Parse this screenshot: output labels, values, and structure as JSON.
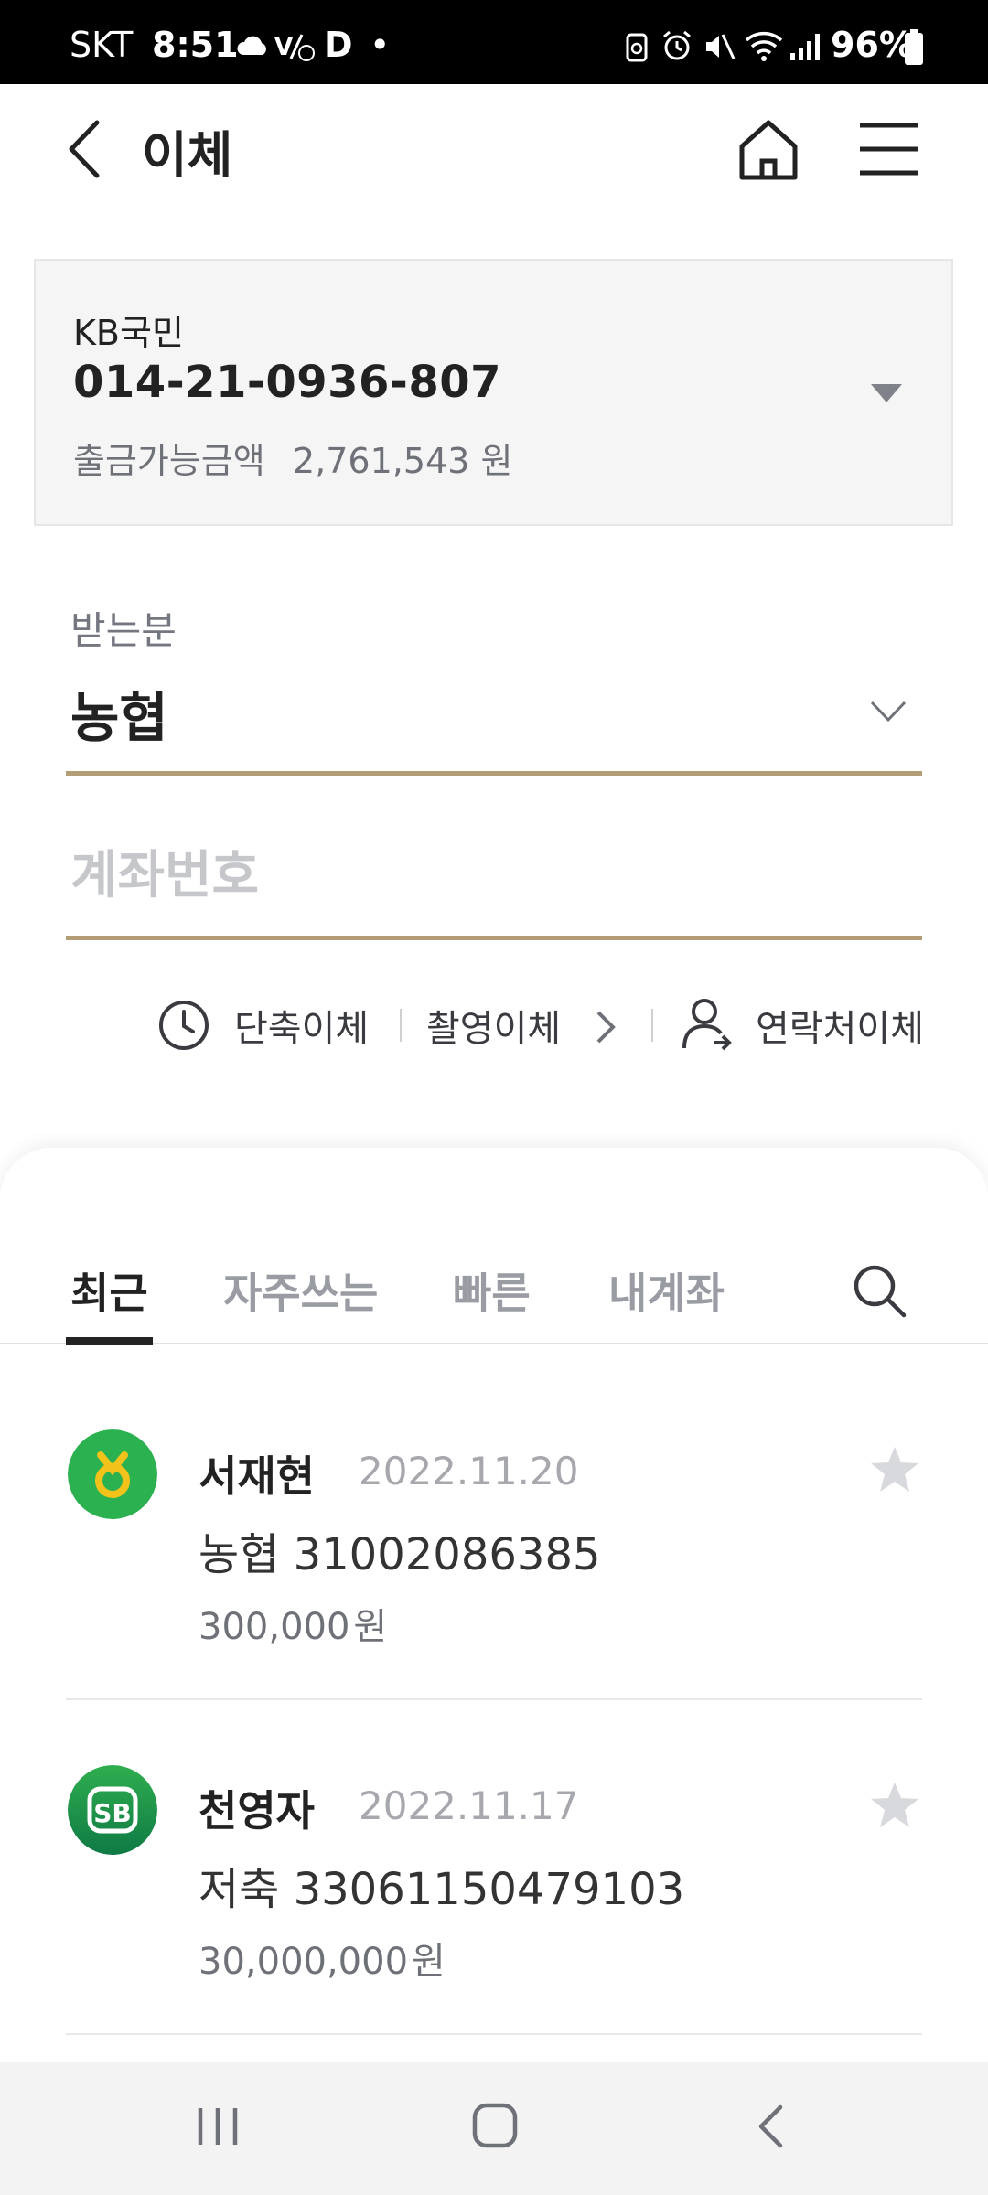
{
  "status_bar": {
    "carrier": "SKT",
    "time": "8:51",
    "extra": "D",
    "dot": "•",
    "battery": "96%"
  },
  "header": {
    "title": "이체",
    "icons": [
      "back-arrow-icon",
      "home-icon",
      "menu-icon"
    ]
  },
  "account": {
    "bank": "KB국민",
    "number": "014-21-0936-807",
    "available_label": "출금가능금액",
    "available_amount": "2,761,543",
    "currency": "원"
  },
  "recipient": {
    "label": "받는분",
    "bank": "농협",
    "account_placeholder": "계좌번호"
  },
  "quick_actions": {
    "shortcut": "단축이체",
    "photo": "촬영이체",
    "contacts": "연락처이체"
  },
  "tabs": [
    "최근",
    "자주쓰는",
    "빠른",
    "내계좌"
  ],
  "recent": [
    {
      "name": "서재현",
      "date": "2022.11.20",
      "bank": "농협",
      "account": "31002086385",
      "amount": "300,000",
      "currency": "원",
      "logo_color": "#2bb14f"
    },
    {
      "name": "천영자",
      "date": "2022.11.17",
      "bank": "저축",
      "account": "33061150479103",
      "amount": "30,000,000",
      "currency": "원",
      "logo_color": "#1e9a4a"
    }
  ],
  "colors": {
    "accent_underline": "#b39d77",
    "star": "#d8d9dc"
  }
}
